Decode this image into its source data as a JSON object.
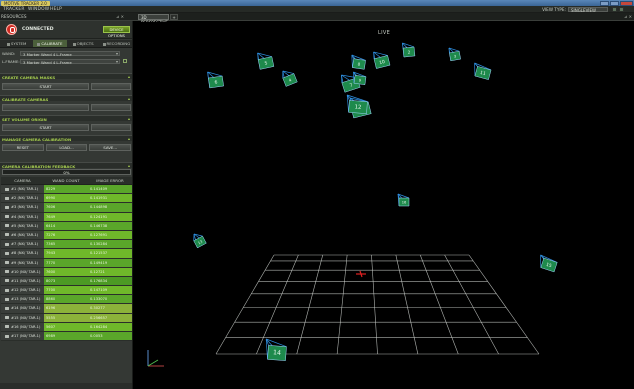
{
  "titlebar": {
    "app_title": "MOTIVE TRACKER 2.0"
  },
  "menubar": {
    "menus": [
      "TRACKER",
      "WINDOW",
      "HELP"
    ],
    "view_type_label": "VIEW TYPE:",
    "view_type_value": "SINGLEVIEW"
  },
  "tabs": {
    "resources": "RESOURCES",
    "view": "3D PERSPECTIVE",
    "view_add": "+"
  },
  "connection": {
    "status": "CONNECTED",
    "options_button": "DEVICE OPTIONS"
  },
  "subtabs": [
    "SYSTEM",
    "CALIBRATE",
    "OBJECTS",
    "RECORDING"
  ],
  "wand": {
    "label": "WAND:",
    "value": "3 Marker Wand 4 L-Frame"
  },
  "lframe": {
    "label": "L-FRAME:",
    "value": "3 Marker Wand 4 L-Frame"
  },
  "sections": {
    "create_masks": "CREATE CAMERA MASKS",
    "create_masks_start": "START",
    "calibrate": "CALIBRATE CAMERAS",
    "volume_origin": "SET VOLUME ORIGIN",
    "volume_origin_start": "START",
    "manage_calibration": "MANAGE CAMERA CALIBRATION",
    "reset": "RESET",
    "load": "LOAD...",
    "save": "SAVE...",
    "feedback": "CAMERA CALIBRATION FEEDBACK"
  },
  "progress": {
    "percent_text": "0%",
    "percent": 0
  },
  "table": {
    "headers": [
      "CAMERA",
      "WAND COUNT",
      "IMAGE ERROR"
    ],
    "rows": [
      {
        "camera": "#1 (NX/ TAR-1)",
        "count": "8229",
        "error": "0.141409",
        "color": "g1"
      },
      {
        "camera": "#2 (NX/ TAR-1)",
        "count": "6990",
        "error": "0.141931",
        "color": "g2"
      },
      {
        "camera": "#3 (NX/ TAR-1)",
        "count": "7606",
        "error": "0.144898",
        "color": "g1"
      },
      {
        "camera": "#4 (NX/ TAR-1)",
        "count": "7649",
        "error": "0.124191",
        "color": "g2"
      },
      {
        "camera": "#5 (NX/ TAR-1)",
        "count": "6414",
        "error": "0.146738",
        "color": "g1"
      },
      {
        "camera": "#6 (NX/ TAR-1)",
        "count": "7276",
        "error": "0.127691",
        "color": "g2"
      },
      {
        "camera": "#7 (NX/ TAR-1)",
        "count": "7365",
        "error": "0.130284",
        "color": "g1"
      },
      {
        "camera": "#8 (NX/ TAR-1)",
        "count": "7943",
        "error": "0.121537",
        "color": "g2"
      },
      {
        "camera": "#9 (NX/ TAR-1)",
        "count": "7770",
        "error": "0.149419",
        "color": "g1"
      },
      {
        "camera": "#10 (NX/ TAR-1)",
        "count": "7600",
        "error": "0.12721",
        "color": "g2"
      },
      {
        "camera": "#11 (NX/ TAR-1)",
        "count": "8073",
        "error": "0.176834",
        "color": "g3"
      },
      {
        "camera": "#12 (NX/ TAR-1)",
        "count": "7700",
        "error": "0.147109",
        "color": "g2"
      },
      {
        "camera": "#13 (NX/ TAR-1)",
        "count": "8860",
        "error": "0.133070",
        "color": "g1"
      },
      {
        "camera": "#14 (NX/ TAR-1)",
        "count": "6196",
        "error": "0.30277",
        "color": "g4"
      },
      {
        "camera": "#15 (NX/ TAR-1)",
        "count": "5555",
        "error": "0.256657",
        "color": "g4"
      },
      {
        "camera": "#16 (NX/ TAR-1)",
        "count": "5607",
        "error": "0.164284",
        "color": "g2"
      },
      {
        "camera": "#17 (NX/ TAR-1)",
        "count": "6989",
        "error": "0.0053",
        "color": "g1"
      }
    ]
  },
  "viewport": {
    "live_label": "LIVE",
    "camera_labels": [
      "5",
      "7",
      "4",
      "1",
      "6",
      "8",
      "2",
      "3",
      "11",
      "9",
      "12",
      "10",
      "16",
      "13",
      "15",
      "14"
    ]
  },
  "colors": {
    "accent_green": "#a8d050",
    "camera_panel": "#1e8a4c",
    "frustum": "#2f8fe0",
    "grid": "#cfd3cf",
    "origin": "#e02020"
  }
}
